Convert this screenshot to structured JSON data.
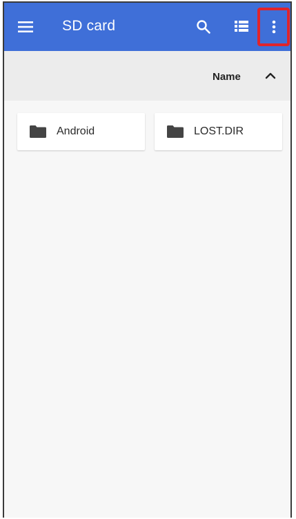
{
  "app_bar": {
    "title": "SD card",
    "menu_icon": "hamburger-menu-icon",
    "search_icon": "search-icon",
    "view_icon": "list-view-icon",
    "overflow_icon": "more-vert-icon",
    "color": "#3f6fd8",
    "highlight_color": "#e0242b"
  },
  "sort_bar": {
    "label": "Name",
    "direction_icon": "chevron-up-icon"
  },
  "files": [
    {
      "name": "Android",
      "icon": "folder-icon"
    },
    {
      "name": "LOST.DIR",
      "icon": "folder-icon"
    }
  ]
}
